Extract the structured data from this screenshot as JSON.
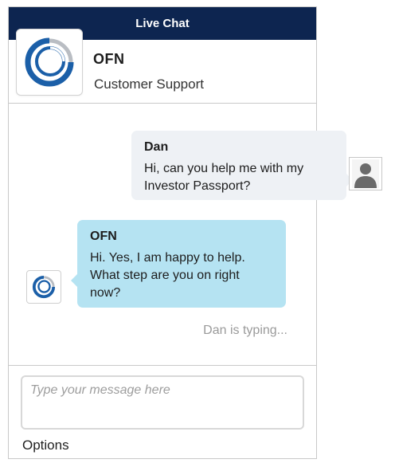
{
  "window": {
    "title": "Live Chat"
  },
  "header": {
    "name": "OFN",
    "subtitle": "Customer Support"
  },
  "messages": [
    {
      "sender": "Dan",
      "text": "Hi, can you help me with my Investor Passport?",
      "side": "right"
    },
    {
      "sender": "OFN",
      "text": "Hi. Yes, I am happy to help. What step are you on right now?",
      "side": "left"
    }
  ],
  "typing_indicator": "Dan is typing...",
  "composer": {
    "placeholder": "Type your message here",
    "value": ""
  },
  "options_label": "Options",
  "icons": {
    "brand_logo": "ofn-ring-logo-icon",
    "user_avatar": "person-silhouette-icon"
  },
  "colors": {
    "title_bar": "#0d2550",
    "user_bubble": "#eef1f5",
    "agent_bubble": "#b5e3f2",
    "logo_blue": "#1b5fa8",
    "logo_gray": "#b9bdc3"
  }
}
